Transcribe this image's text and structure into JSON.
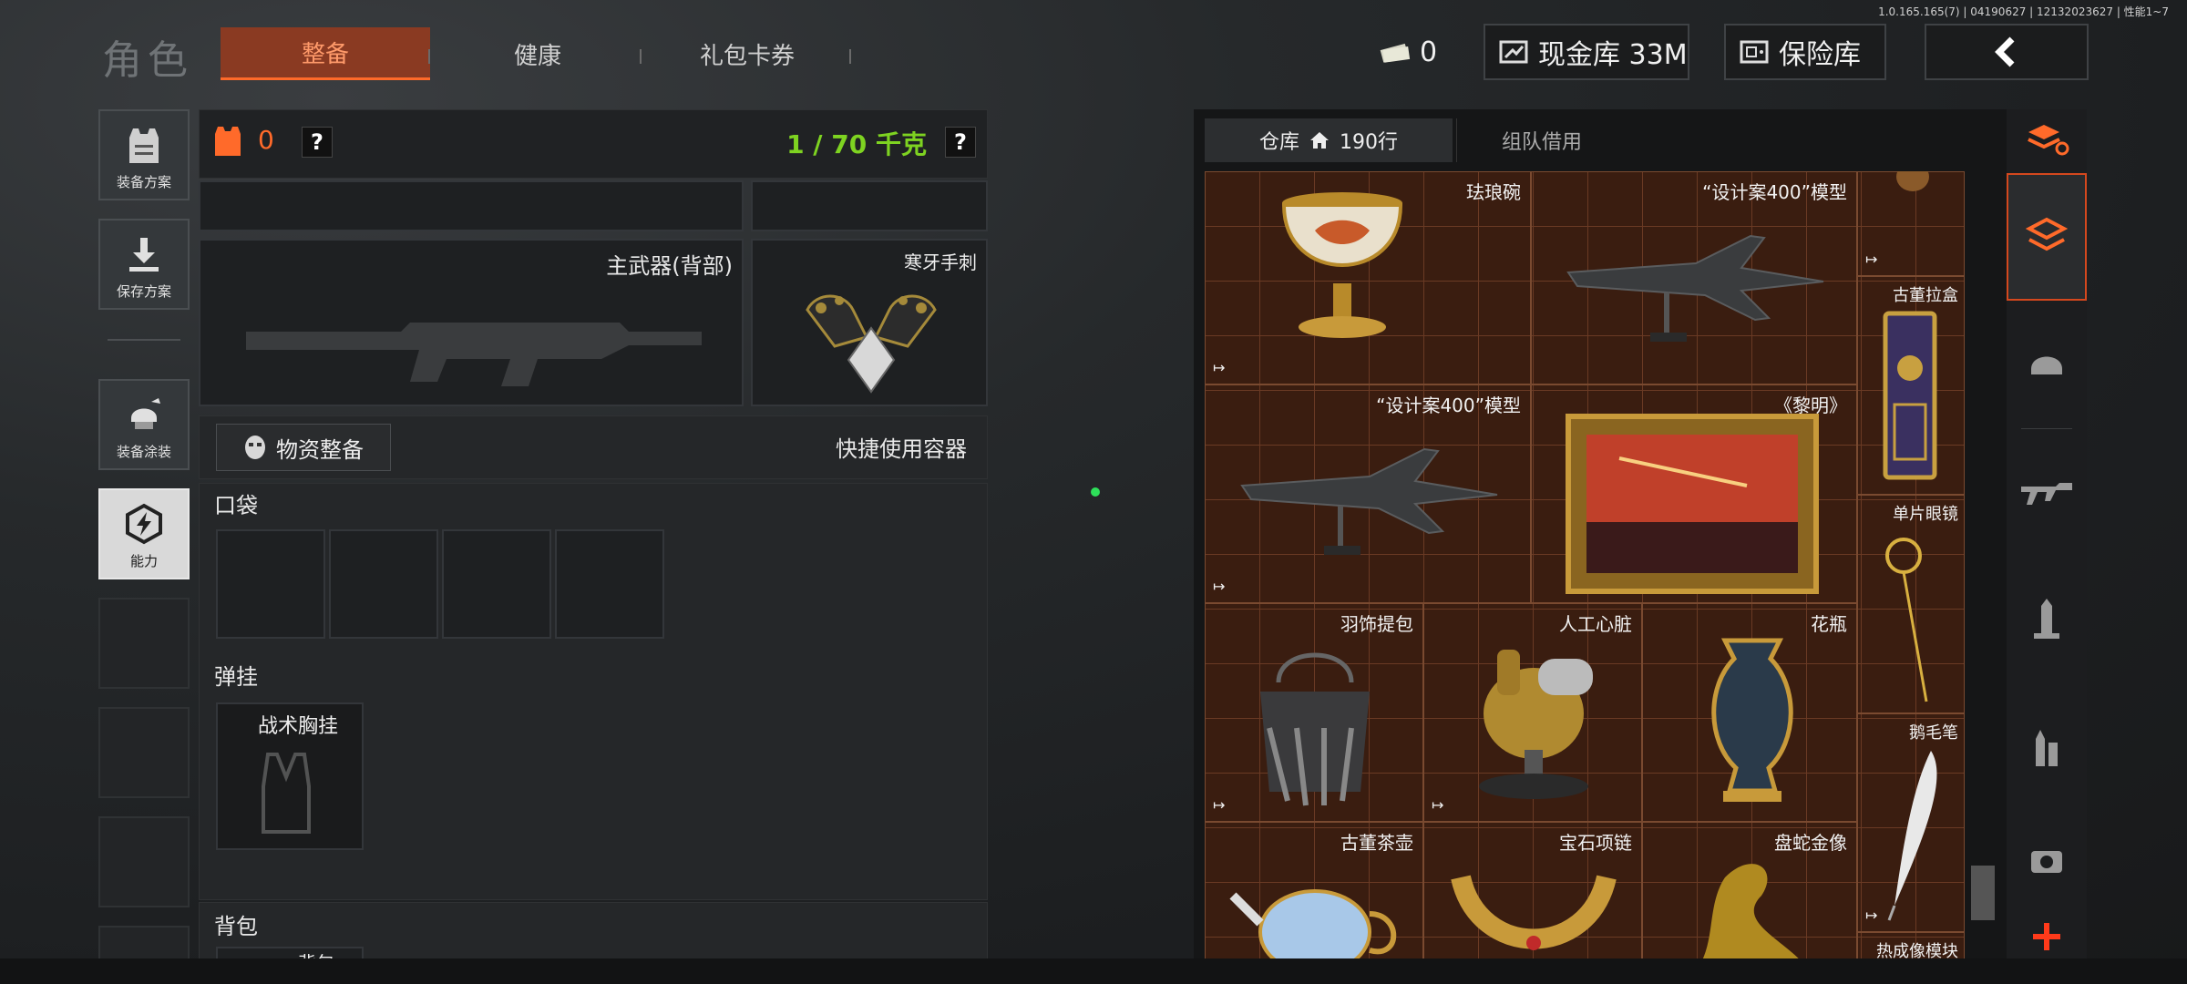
{
  "version": "1.0.165.165(7) | 04190627 | 12132023627 | 性能1~7",
  "header": {
    "title": "角色",
    "tabs": [
      {
        "label": "整备",
        "active": true
      },
      {
        "label": "健康",
        "active": false
      },
      {
        "label": "礼包卡券",
        "active": false
      }
    ],
    "cash_count": "0",
    "cash_vault_label": "现金库 33M",
    "safe_label": "保险库",
    "back_icon": "chevron-left-icon"
  },
  "sidebar": {
    "buttons": [
      {
        "label": "装备方案",
        "icon": "armor-vest-icon"
      },
      {
        "label": "保存方案",
        "icon": "download-arrow-icon"
      },
      {
        "label": "装备涂装",
        "icon": "helmet-paint-icon"
      },
      {
        "label": "能力",
        "icon": "lightning-shield-icon",
        "active": true
      }
    ]
  },
  "loadout": {
    "armor_value": "0",
    "help_label": "?",
    "weight_text": "1 / 70 千克",
    "primary_weapon_label": "主武器(背部)",
    "melee_label": "寒牙手刺",
    "supplies_button": "物资整备",
    "quick_container": "快捷使用容器",
    "pocket_label": "口袋",
    "rig_section_label": "弹挂",
    "rig_item_label": "战术胸挂",
    "backpack_label": "背包",
    "backpack_item_partial": "背包"
  },
  "warehouse": {
    "tab_storage": "仓库",
    "storage_rows": "190行",
    "tab_team": "组队借用",
    "items": [
      {
        "name": "珐琅碗"
      },
      {
        "name": "“设计案400”模型"
      },
      {
        "name": "“设计案400”模型"
      },
      {
        "name": "《黎明》"
      },
      {
        "name": "羽饰提包"
      },
      {
        "name": "人工心脏"
      },
      {
        "name": "花瓶"
      },
      {
        "name": "古董茶壶"
      },
      {
        "name": "宝石项链"
      },
      {
        "name": "盘蛇金像"
      },
      {
        "name": "古董拉盒"
      },
      {
        "name": "单片眼镜"
      },
      {
        "name": "鹅毛笔"
      },
      {
        "name": "热成像模块"
      }
    ],
    "side_nav": [
      "layers-refresh-icon",
      "box-arrow-icon",
      "helmet-icon",
      "rifle-icon",
      "ammo-cartridge-icon",
      "bullets-icon",
      "gadget-icon",
      "plus-icon"
    ]
  },
  "colors": {
    "accent": "#ff6a2a",
    "weight_green": "#7ed321",
    "grid_bg": "#3a1d10"
  }
}
